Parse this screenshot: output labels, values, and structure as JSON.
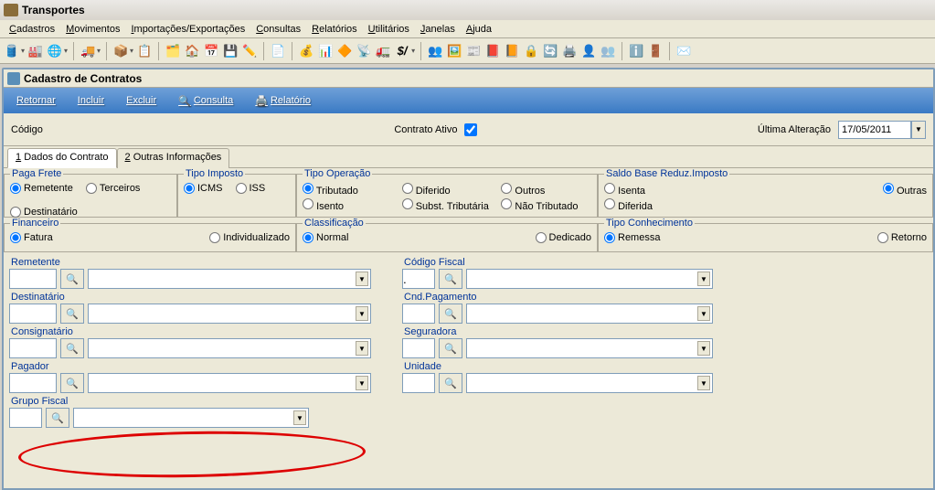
{
  "window": {
    "title": "Transportes"
  },
  "menu": [
    "Cadastros",
    "Movimentos",
    "Importações/Exportações",
    "Consultas",
    "Relatórios",
    "Utilitários",
    "Janelas",
    "Ajuda"
  ],
  "menu_underline": [
    "C",
    "M",
    "I",
    "C",
    "R",
    "U",
    "J",
    "A"
  ],
  "subwindow": {
    "title": "Cadastro de Contratos"
  },
  "actions": {
    "retornar": "Retornar",
    "incluir": "Incluir",
    "excluir": "Excluir",
    "consulta": "Consulta",
    "relatorio": "Relatório"
  },
  "header": {
    "codigo_label": "Código",
    "contrato_ativo_label": "Contrato Ativo",
    "contrato_ativo_checked": true,
    "ultima_alteracao_label": "Última Alteração",
    "ultima_alteracao_value": "17/05/2011"
  },
  "tabs": {
    "t1": "1 Dados do Contrato",
    "t2": "2 Outras Informações"
  },
  "fieldsets": {
    "paga_frete": {
      "legend": "Paga Frete",
      "remetente": "Remetente",
      "terceiros": "Terceiros",
      "destinatario": "Destinatário"
    },
    "tipo_imposto": {
      "legend": "Tipo Imposto",
      "icms": "ICMS",
      "iss": "ISS"
    },
    "tipo_operacao": {
      "legend": "Tipo Operação",
      "tributado": "Tributado",
      "isento": "Isento",
      "diferido": "Diferido",
      "subst": "Subst. Tributária",
      "outros": "Outros",
      "naotrib": "Não Tributado"
    },
    "saldo": {
      "legend": "Saldo Base Reduz.Imposto",
      "isenta": "Isenta",
      "diferida": "Diferida",
      "outras": "Outras"
    },
    "financeiro": {
      "legend": "Financeiro",
      "fatura": "Fatura",
      "individ": "Individualizado"
    },
    "classif": {
      "legend": "Classificação",
      "normal": "Normal",
      "dedicado": "Dedicado"
    },
    "tipoconh": {
      "legend": "Tipo Conhecimento",
      "remessa": "Remessa",
      "retorno": "Retorno"
    }
  },
  "lookups": {
    "remetente": "Remetente",
    "destinatario": "Destinatário",
    "consignatario": "Consignatário",
    "pagador": "Pagador",
    "grupofiscal": "Grupo Fiscal",
    "codfiscal": "Código Fiscal",
    "codfiscal_placeholder": ".",
    "cndpag": "Cnd.Pagamento",
    "seguradora": "Seguradora",
    "unidade": "Unidade"
  }
}
